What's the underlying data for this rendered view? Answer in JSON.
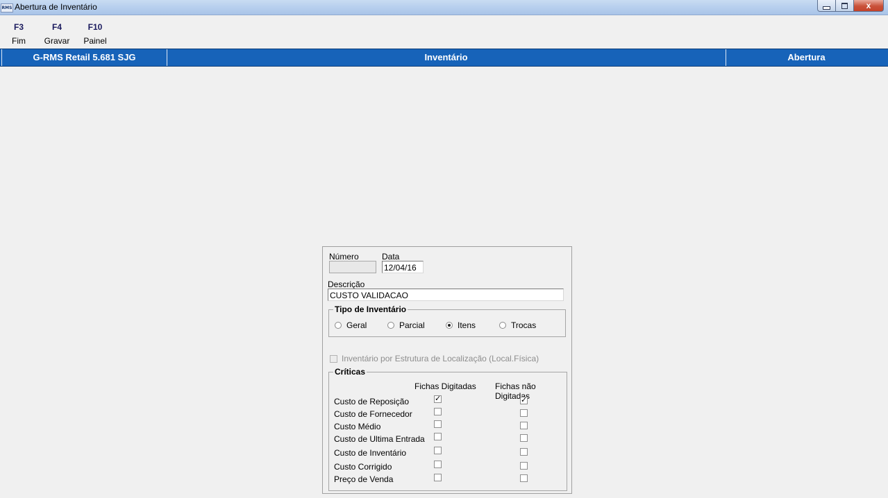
{
  "window": {
    "title": "Abertura de Inventário",
    "icon_text": "RMS",
    "close_label": "x"
  },
  "toolbar": [
    {
      "key": "F3",
      "label": "Fim"
    },
    {
      "key": "F4",
      "label": "Gravar"
    },
    {
      "key": "F10",
      "label": "Painel"
    }
  ],
  "header": {
    "system": "G-RMS Retail 5.681 SJG",
    "module": "Inventário",
    "action": "Abertura"
  },
  "form": {
    "numero_label": "Número",
    "numero_value": "",
    "data_label": "Data",
    "data_value": "12/04/16",
    "descricao_label": "Descrição",
    "descricao_value": "CUSTO VALIDACAO",
    "tipo_title": "Tipo de Inventário",
    "tipo_options": [
      "Geral",
      "Parcial",
      "Itens",
      "Trocas"
    ],
    "tipo_selected": "Itens",
    "localizacao_label": "Inventário por Estrutura de Localização (Local.Física)",
    "localizacao_checked": false,
    "criticas_title": "Críticas",
    "col_digitadas": "Fichas Digitadas",
    "col_nao_digitadas": "Fichas não Digitadas",
    "criticas": [
      {
        "label": "Custo de Reposição",
        "digitadas": true,
        "nao_digitadas": true
      },
      {
        "label": "Custo de Fornecedor",
        "digitadas": false,
        "nao_digitadas": false
      },
      {
        "label": "Custo Médio",
        "digitadas": false,
        "nao_digitadas": false
      },
      {
        "label": "Custo de Ultima Entrada",
        "digitadas": false,
        "nao_digitadas": false
      },
      {
        "label": "Custo de Inventário",
        "digitadas": false,
        "nao_digitadas": false
      },
      {
        "label": "Custo Corrigido",
        "digitadas": false,
        "nao_digitadas": false
      },
      {
        "label": "Preço de Venda",
        "digitadas": false,
        "nao_digitadas": false
      }
    ]
  },
  "colors": {
    "header_bg": "#1763b9",
    "window_bg": "#f0f0f0"
  }
}
